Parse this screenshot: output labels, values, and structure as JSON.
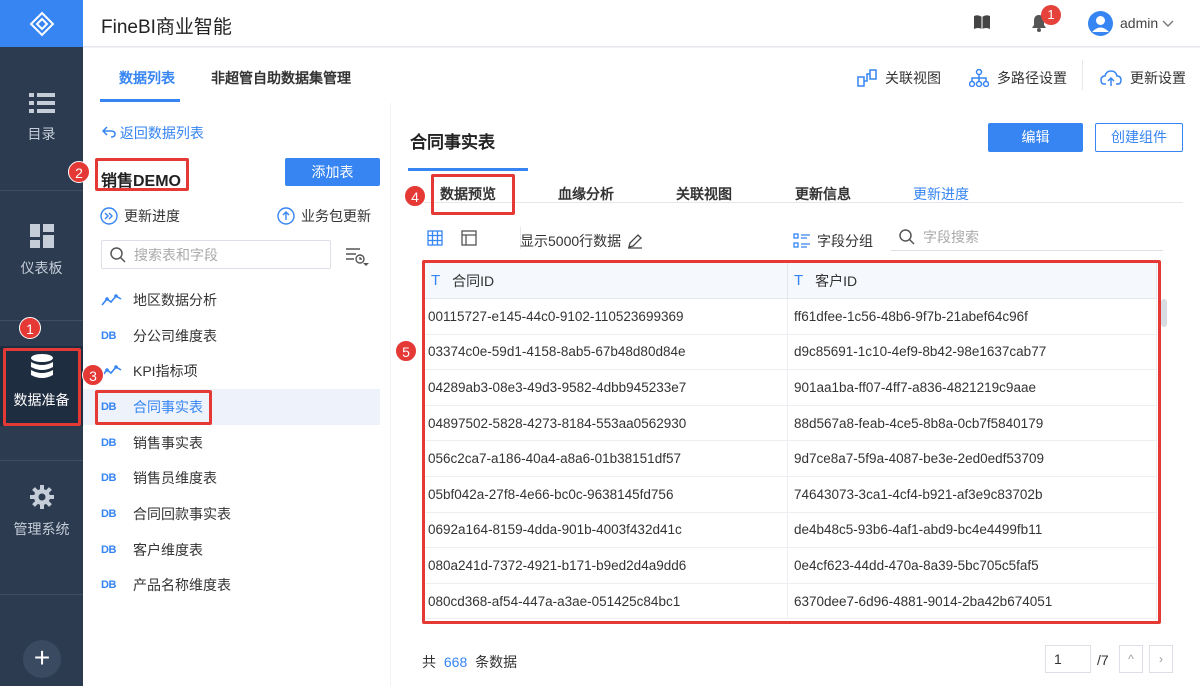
{
  "app": {
    "title": "FineBI商业智能",
    "user": "admin",
    "notifications": "1"
  },
  "nav": {
    "items": [
      {
        "label": "目录",
        "icon": "list-icon"
      },
      {
        "label": "仪表板",
        "icon": "dashboard-icon"
      },
      {
        "label": "数据准备",
        "icon": "database-icon"
      },
      {
        "label": "管理系统",
        "icon": "gear-icon"
      }
    ],
    "add": "+"
  },
  "subheader": {
    "tabs": [
      "数据列表",
      "非超管自助数据集管理"
    ],
    "actions": [
      "关联视图",
      "多路径设置",
      "更新设置"
    ]
  },
  "left": {
    "back": "返回数据列表",
    "package_name": "销售DEMO",
    "add_table": "添加表",
    "update_progress": "更新进度",
    "package_update": "业务包更新",
    "search_placeholder": "搜索表和字段",
    "tables": [
      {
        "label": "地区数据分析",
        "type": "analysis"
      },
      {
        "label": "分公司维度表",
        "type": "DB"
      },
      {
        "label": "KPI指标项",
        "type": "analysis"
      },
      {
        "label": "合同事实表",
        "type": "DB"
      },
      {
        "label": "销售事实表",
        "type": "DB"
      },
      {
        "label": "销售员维度表",
        "type": "DB"
      },
      {
        "label": "合同回款事实表",
        "type": "DB"
      },
      {
        "label": "客户维度表",
        "type": "DB"
      },
      {
        "label": "产品名称维度表",
        "type": "DB"
      }
    ],
    "db_tag": "DB"
  },
  "main": {
    "title": "合同事实表",
    "edit": "编辑",
    "create": "创建组件",
    "tabs": [
      "数据预览",
      "血缘分析",
      "关联视图",
      "更新信息",
      "更新进度"
    ],
    "show_rows": "显示5000行数据",
    "field_group": "字段分组",
    "field_search_placeholder": "字段搜索",
    "columns": [
      "合同ID",
      "客户ID"
    ],
    "column_type_icon": "T",
    "rows": [
      [
        "00115727-e145-44c0-9102-110523699369",
        "ff61dfee-1c56-48b6-9f7b-21abef64c96f"
      ],
      [
        "03374c0e-59d1-4158-8ab5-67b48d80d84e",
        "d9c85691-1c10-4ef9-8b42-98e1637cab77"
      ],
      [
        "04289ab3-08e3-49d3-9582-4dbb945233e7",
        "901aa1ba-ff07-4ff7-a836-4821219c9aae"
      ],
      [
        "04897502-5828-4273-8184-553aa0562930",
        "88d567a8-feab-4ce5-8b8a-0cb7f5840179"
      ],
      [
        "056c2ca7-a186-40a4-a8a6-01b38151df57",
        "9d7ce8a7-5f9a-4087-be3e-2ed0edf53709"
      ],
      [
        "05bf042a-27f8-4e66-bc0c-9638145fd756",
        "74643073-3ca1-4cf4-b921-af3e9c83702b"
      ],
      [
        "0692a164-8159-4dda-901b-4003f432d41c",
        "de4b48c5-93b6-4af1-abd9-bc4e4499fb11"
      ],
      [
        "080a241d-7372-4921-b171-b9ed2d4a9dd6",
        "0e4cf623-44dd-470a-8a39-5bc705c5faf5"
      ],
      [
        "080cd368-af54-447a-a3ae-051425c84bc1",
        "6370dee7-6d96-4881-9014-2ba42b674051"
      ]
    ],
    "footer": {
      "prefix": "共",
      "count": "668",
      "suffix": "条数据",
      "page": "1",
      "total": "/7",
      "prev": "^",
      "next": "›"
    }
  },
  "annotations": [
    "1",
    "2",
    "3",
    "4",
    "5"
  ],
  "colors": {
    "accent": "#3685f2",
    "nav_bg": "#2c3b50",
    "annotation": "#e53935"
  }
}
